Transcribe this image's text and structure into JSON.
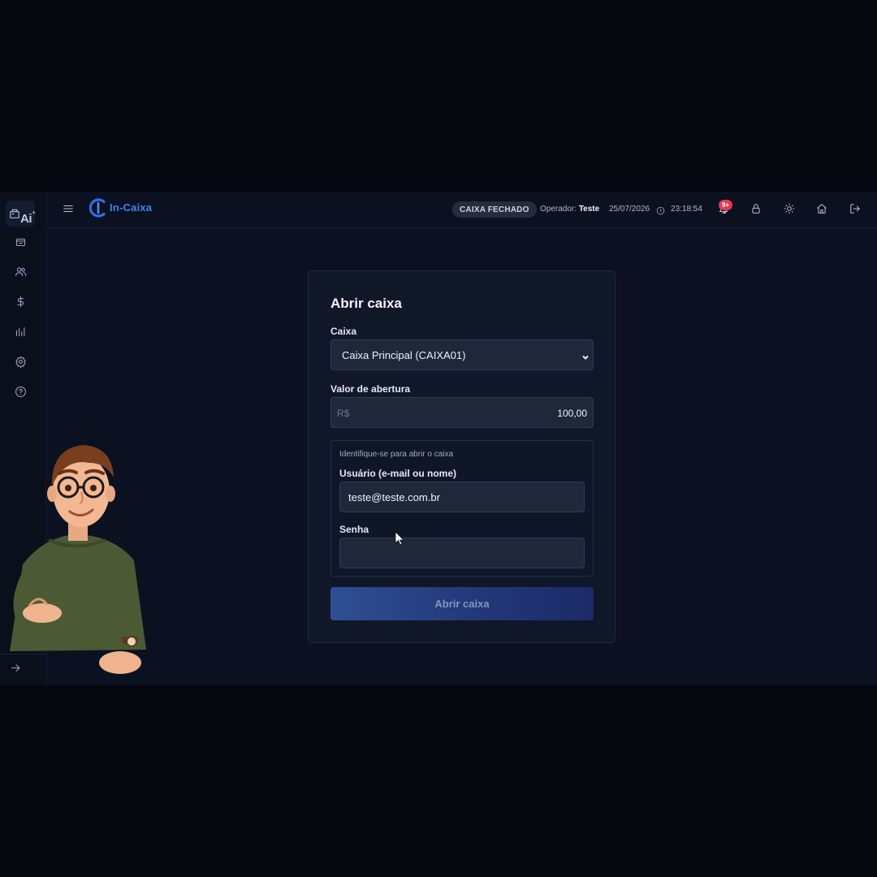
{
  "sidebar": {
    "items": [
      {
        "icon": "cash-register-ai-icon",
        "active": true,
        "ai_label": "Ai",
        "ai_plus": "+"
      },
      {
        "icon": "cart-icon"
      },
      {
        "icon": "users-icon"
      },
      {
        "icon": "dollar-icon"
      },
      {
        "icon": "bar-chart-icon"
      },
      {
        "icon": "settings-icon"
      },
      {
        "icon": "help-icon"
      }
    ],
    "expand_icon": "arrow-right-icon"
  },
  "header": {
    "menu_icon": "hamburger-icon",
    "brand": "In-Caixa",
    "status": "CAIXA FECHADO",
    "operator_label": "Operador:",
    "operator_name": "Teste",
    "date": "25/07/2026",
    "time": "23:18:54",
    "notifications_badge": "9+",
    "icons": [
      "bell-icon",
      "lock-icon",
      "sun-icon",
      "home-icon",
      "logout-icon"
    ]
  },
  "form": {
    "title": "Abrir caixa",
    "caixa_label": "Caixa",
    "caixa_selected": "Caixa Principal (CAIXA01)",
    "valor_label": "Valor de abertura",
    "valor_prefix": "R$",
    "valor_value": "100,00",
    "auth_hint": "Identifique-se para abrir o caixa",
    "user_label": "Usuário (e-mail ou nome)",
    "user_value": "teste@teste.com.br",
    "password_label": "Senha",
    "password_value": "",
    "submit_label": "Abrir caixa"
  },
  "colors": {
    "accent": "#3b82f6",
    "badge": "#e53950",
    "background": "#0b1120"
  }
}
